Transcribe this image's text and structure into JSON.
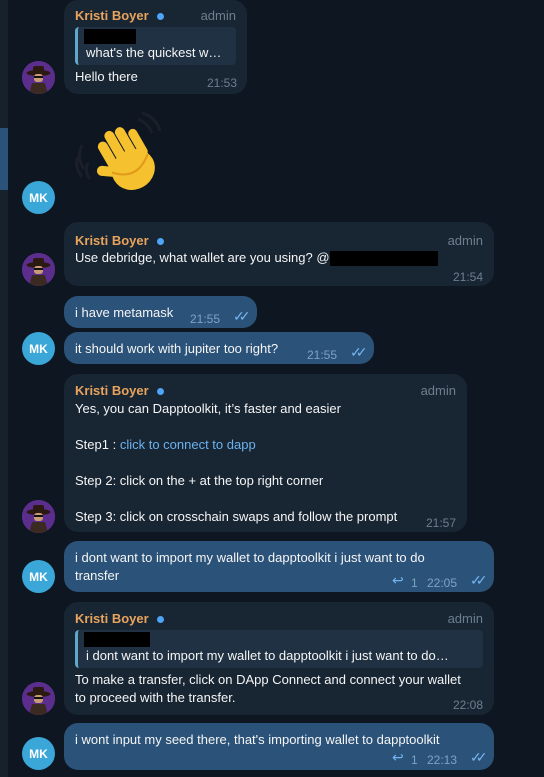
{
  "chat": {
    "messages": [
      {
        "sender": "Kristi Boyer",
        "role": "admin",
        "quote": "what's the quickest w…",
        "text": "Hello there",
        "time": "21:53"
      },
      {
        "emoji": "👋"
      },
      {
        "sender": "Kristi Boyer",
        "role": "admin",
        "text": "Use debridge, what wallet are you using? @",
        "time": "21:54"
      },
      {
        "text": "i have metamask",
        "time": "21:55"
      },
      {
        "text": "it should work with jupiter too right?",
        "time": "21:55"
      },
      {
        "sender": "Kristi Boyer",
        "role": "admin",
        "line1": "Yes, you can Dapptoolkit, it’s faster and easier",
        "line2_prefix": "Step1 : ",
        "line2_link": "click to connect to dapp",
        "line3": "Step 2: click on the + at the top right corner",
        "line4": "Step 3: click on crosschain swaps and follow the prompt",
        "time": "21:57"
      },
      {
        "line1": "i dont want to import my wallet to dapptoolkit i just want to do",
        "line2": "transfer",
        "replies": "1",
        "time": "22:05"
      },
      {
        "sender": "Kristi Boyer",
        "role": "admin",
        "quote": "i dont want to import my wallet to dapptoolkit i just want to do…",
        "line1": "To make a transfer, click on DApp Connect and connect your wallet",
        "line2": "to proceed with the transfer.",
        "time": "22:08"
      },
      {
        "text": "i wont input my seed there, that's importing wallet to dapptoolkit",
        "replies": "1",
        "time": "22:13"
      }
    ],
    "avatars": {
      "mk_initials": "MK"
    },
    "colors": {
      "background": "#0e1621",
      "incoming": "#182533",
      "outgoing": "#2b5278",
      "sender_name": "#e8a35d",
      "link": "#6cb2ef"
    }
  }
}
